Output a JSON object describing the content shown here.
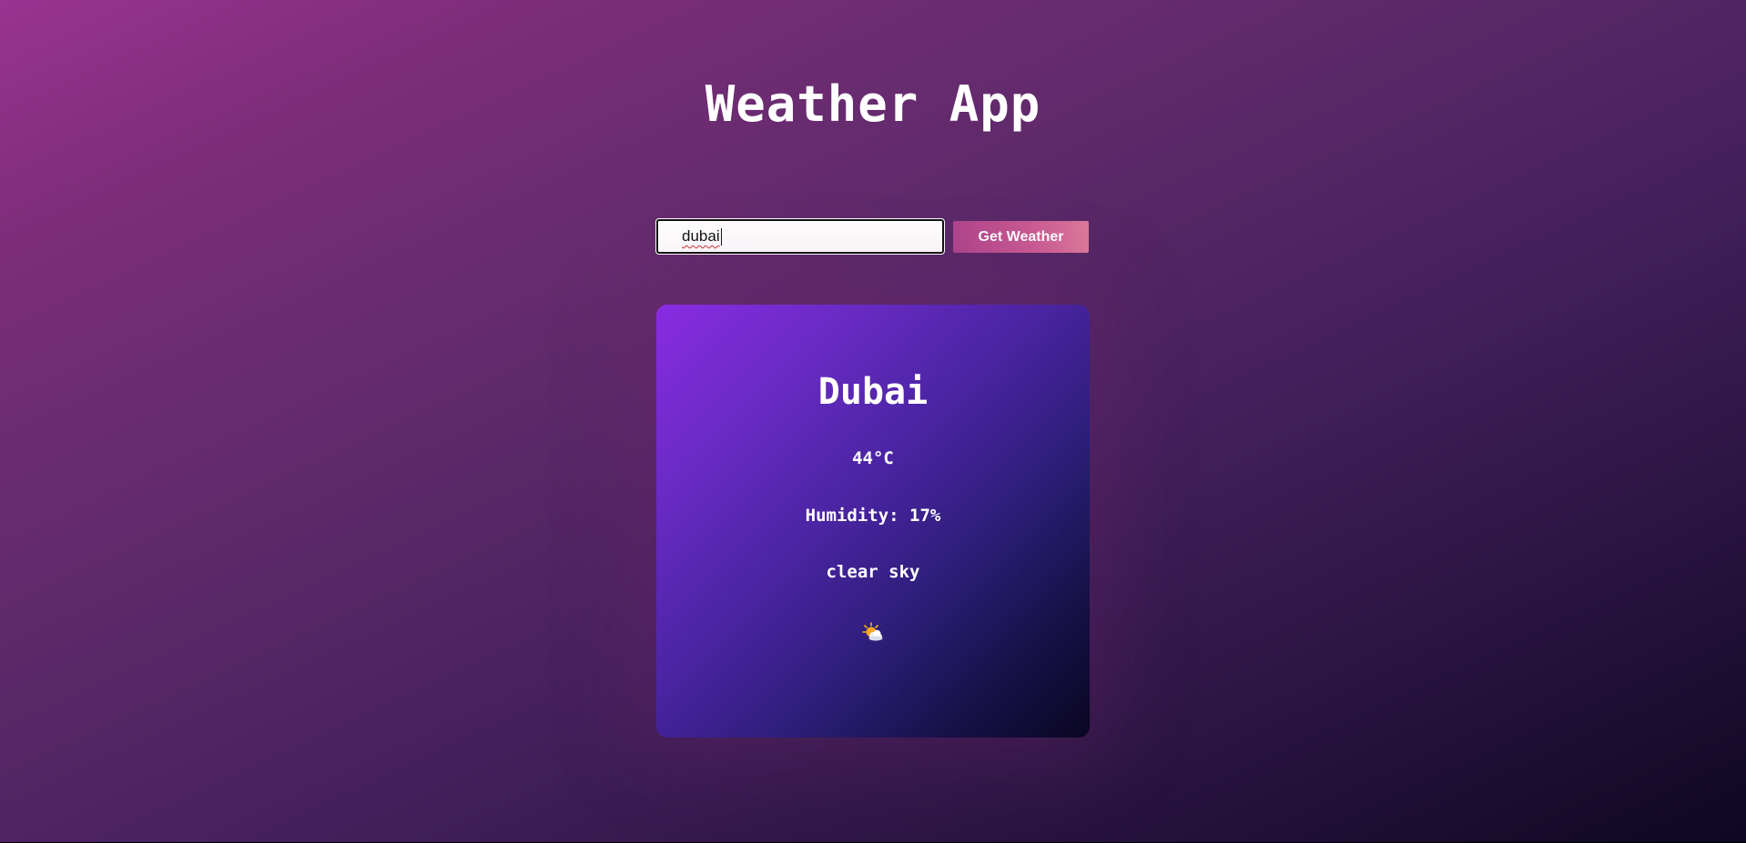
{
  "app": {
    "title": "Weather App"
  },
  "search": {
    "input_value": "dubai",
    "button_label": "Get Weather"
  },
  "weather": {
    "city": "Dubai",
    "temperature": "44°C",
    "humidity": "Humidity: 17%",
    "description": "clear sky",
    "icon": "sun-behind-cloud-icon"
  },
  "colors": {
    "button_gradient_start": "#b0458c",
    "button_gradient_end": "#de7a9b",
    "card_gradient_start": "#8a2be2",
    "card_gradient_end": "#0a0622",
    "text": "#ffffff"
  }
}
